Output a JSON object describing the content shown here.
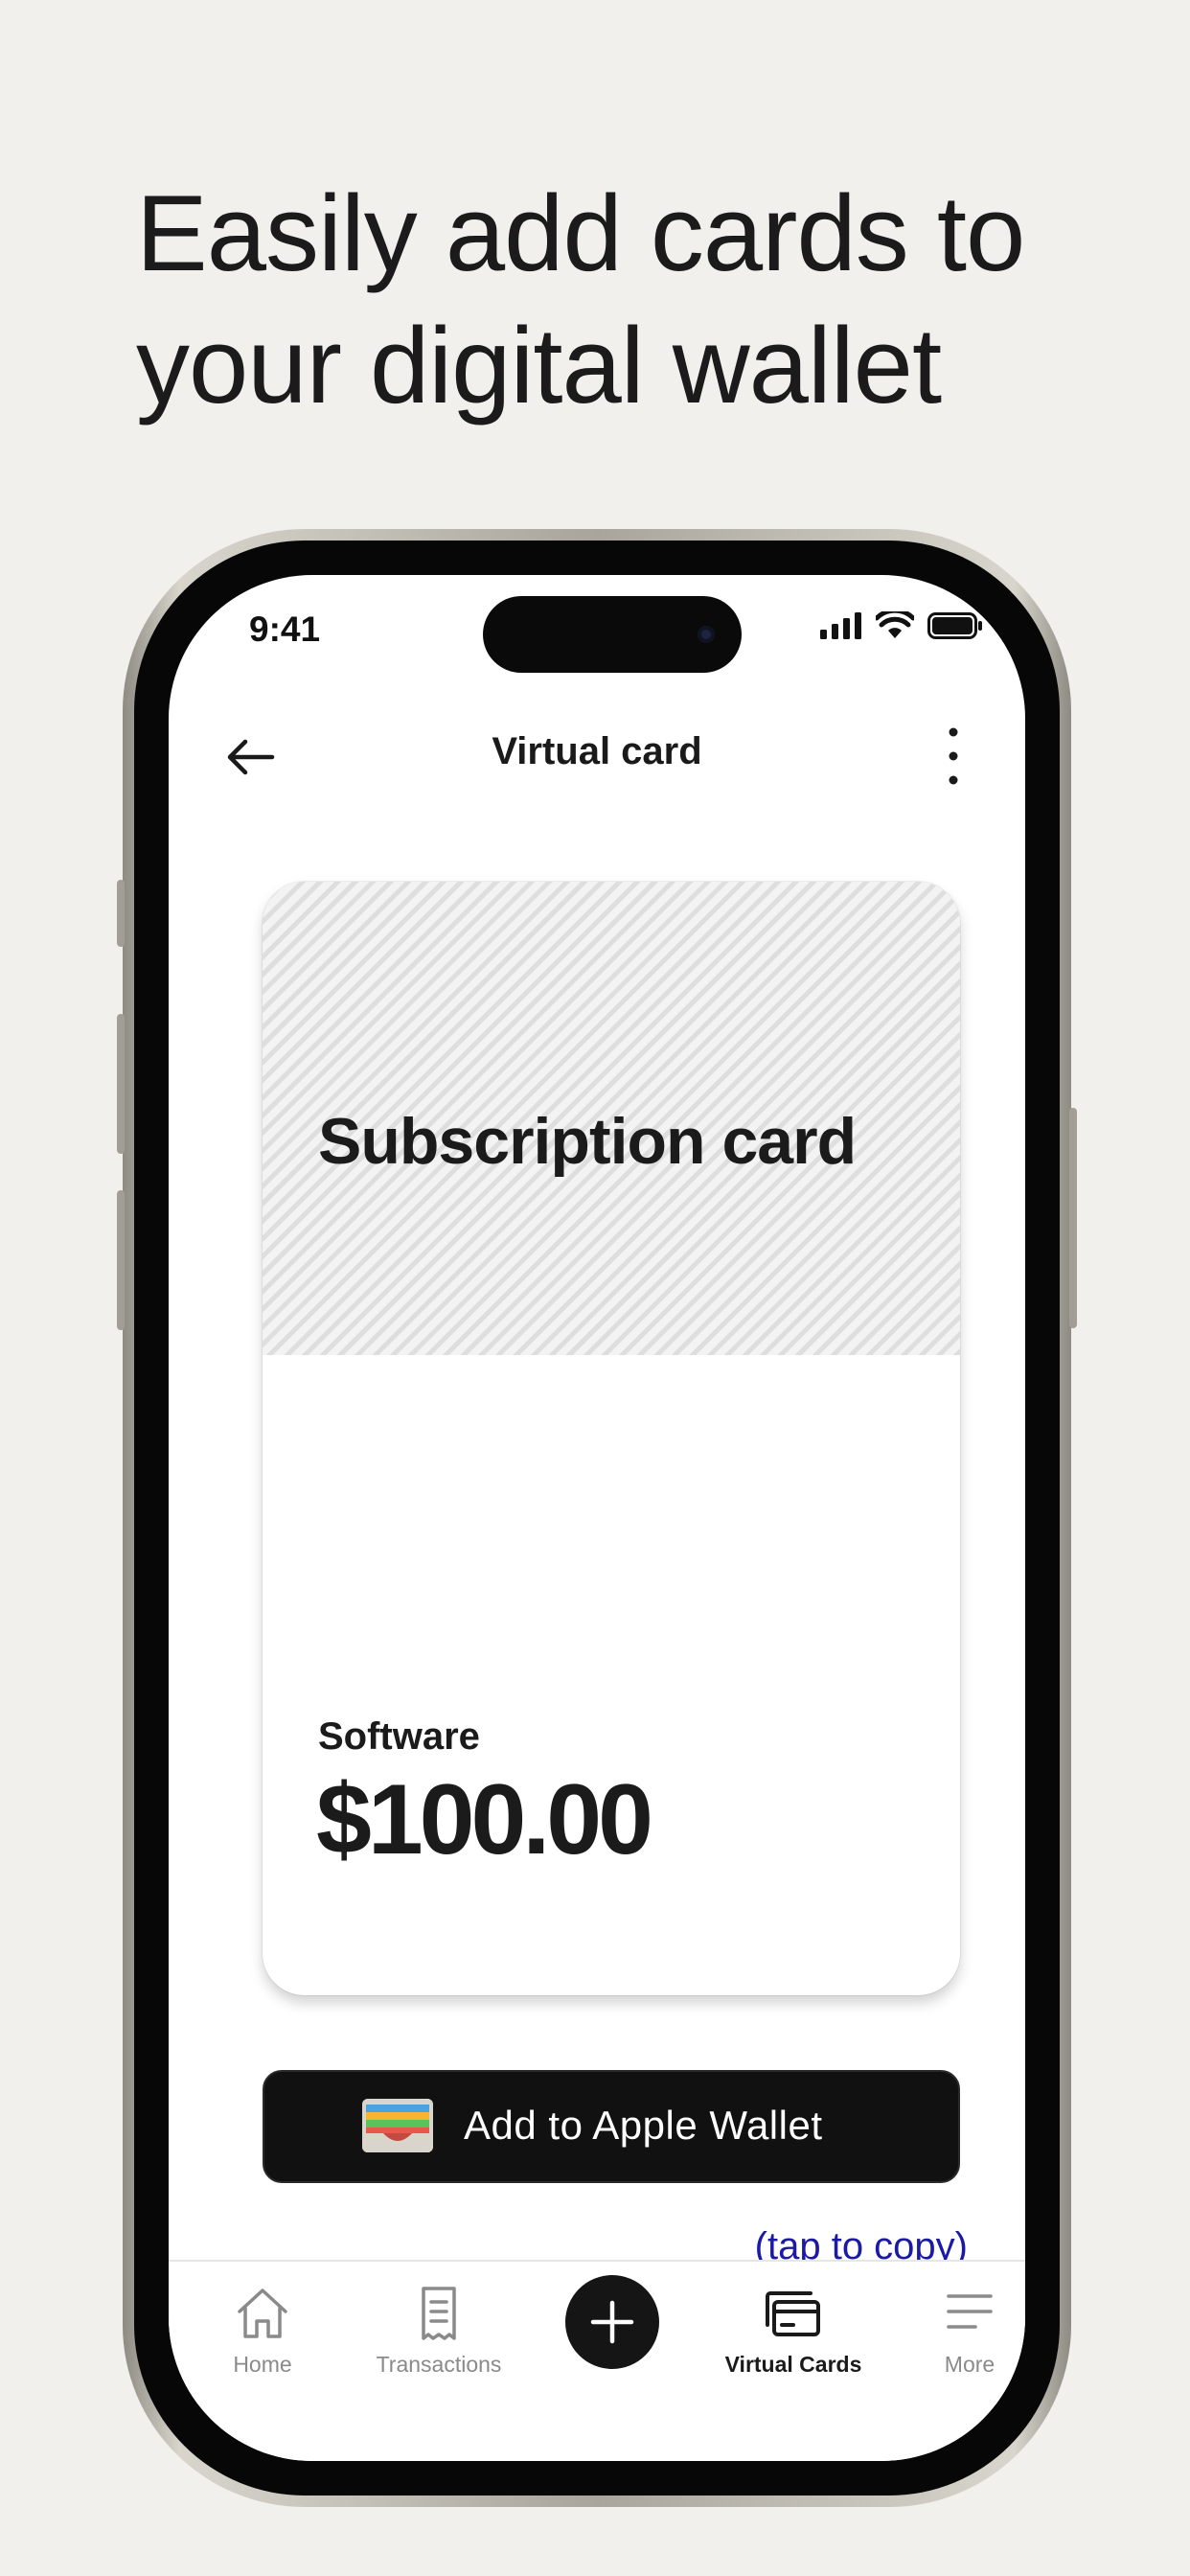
{
  "headline": {
    "line1": "Easily add cards to",
    "line2": "your digital wallet"
  },
  "status_bar": {
    "time": "9:41",
    "icons": [
      "signal-icon",
      "wifi-icon",
      "battery-icon"
    ]
  },
  "nav": {
    "title": "Virtual card",
    "back_icon": "arrow-left-icon",
    "more_icon": "more-vertical-icon"
  },
  "card": {
    "name": "Subscription card",
    "category": "Software",
    "amount": "$100.00"
  },
  "wallet_button": {
    "label": "Add to Apple Wallet",
    "icon": "apple-wallet-icon"
  },
  "tap_to_copy": "(tap to copy)",
  "tab_bar": {
    "tabs": [
      {
        "label": "Home",
        "icon": "home-icon",
        "active": false
      },
      {
        "label": "Transactions",
        "icon": "receipt-icon",
        "active": false
      },
      {
        "label": "",
        "icon": "plus-icon",
        "active": false
      },
      {
        "label": "Virtual Cards",
        "icon": "cards-icon",
        "active": true
      },
      {
        "label": "More",
        "icon": "menu-icon",
        "active": false
      }
    ]
  },
  "colors": {
    "background": "#f1f0ed",
    "link": "#1a1aa6",
    "dark": "#111111"
  }
}
